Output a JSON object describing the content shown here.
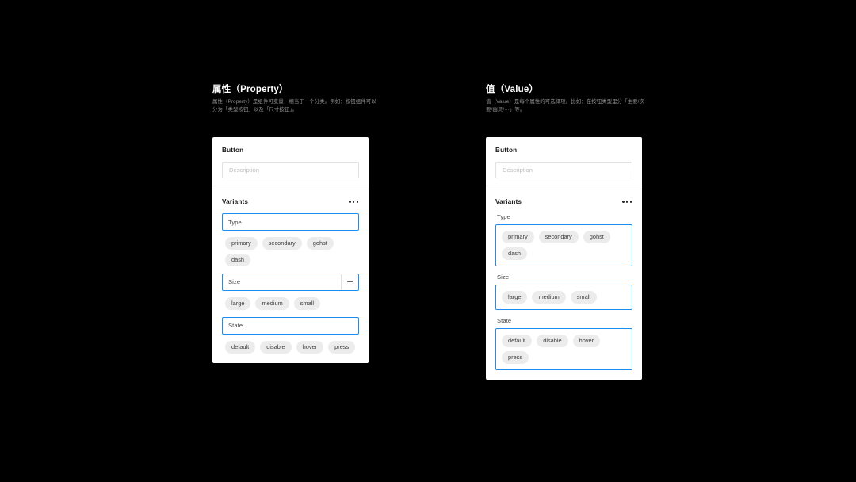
{
  "sections": [
    {
      "id": "property",
      "title": "属性（Property）",
      "description": "属性（Property）是组件可变量，相当于一个分类。例如：按钮组件可以分为「类型按钮」以及「尺寸按钮」。"
    },
    {
      "id": "value",
      "title": "值（Value）",
      "description": "值（Value）是每个属性的可选择项。比如：在按钮类型里分「主要/次要/幽灵/···」等。"
    }
  ],
  "card": {
    "title": "Button",
    "description_placeholder": "Description",
    "variants_label": "Variants",
    "more_icon": "more-horizontal-icon",
    "remove_icon": "minus-icon"
  },
  "properties": [
    {
      "name": "Type",
      "has_remove": false,
      "values": [
        "primary",
        "secondary",
        "gohst",
        "dash"
      ]
    },
    {
      "name": "Size",
      "has_remove": true,
      "values": [
        "large",
        "medium",
        "small"
      ]
    },
    {
      "name": "State",
      "has_remove": false,
      "values": [
        "default",
        "disable",
        "hover",
        "press"
      ]
    }
  ],
  "colors": {
    "background": "#000000",
    "card": "#ffffff",
    "accent_blue": "#1c8cf0",
    "chip": "#ececec",
    "title_text": "#1a1a1a",
    "desc_text": "#8d8d8d"
  }
}
